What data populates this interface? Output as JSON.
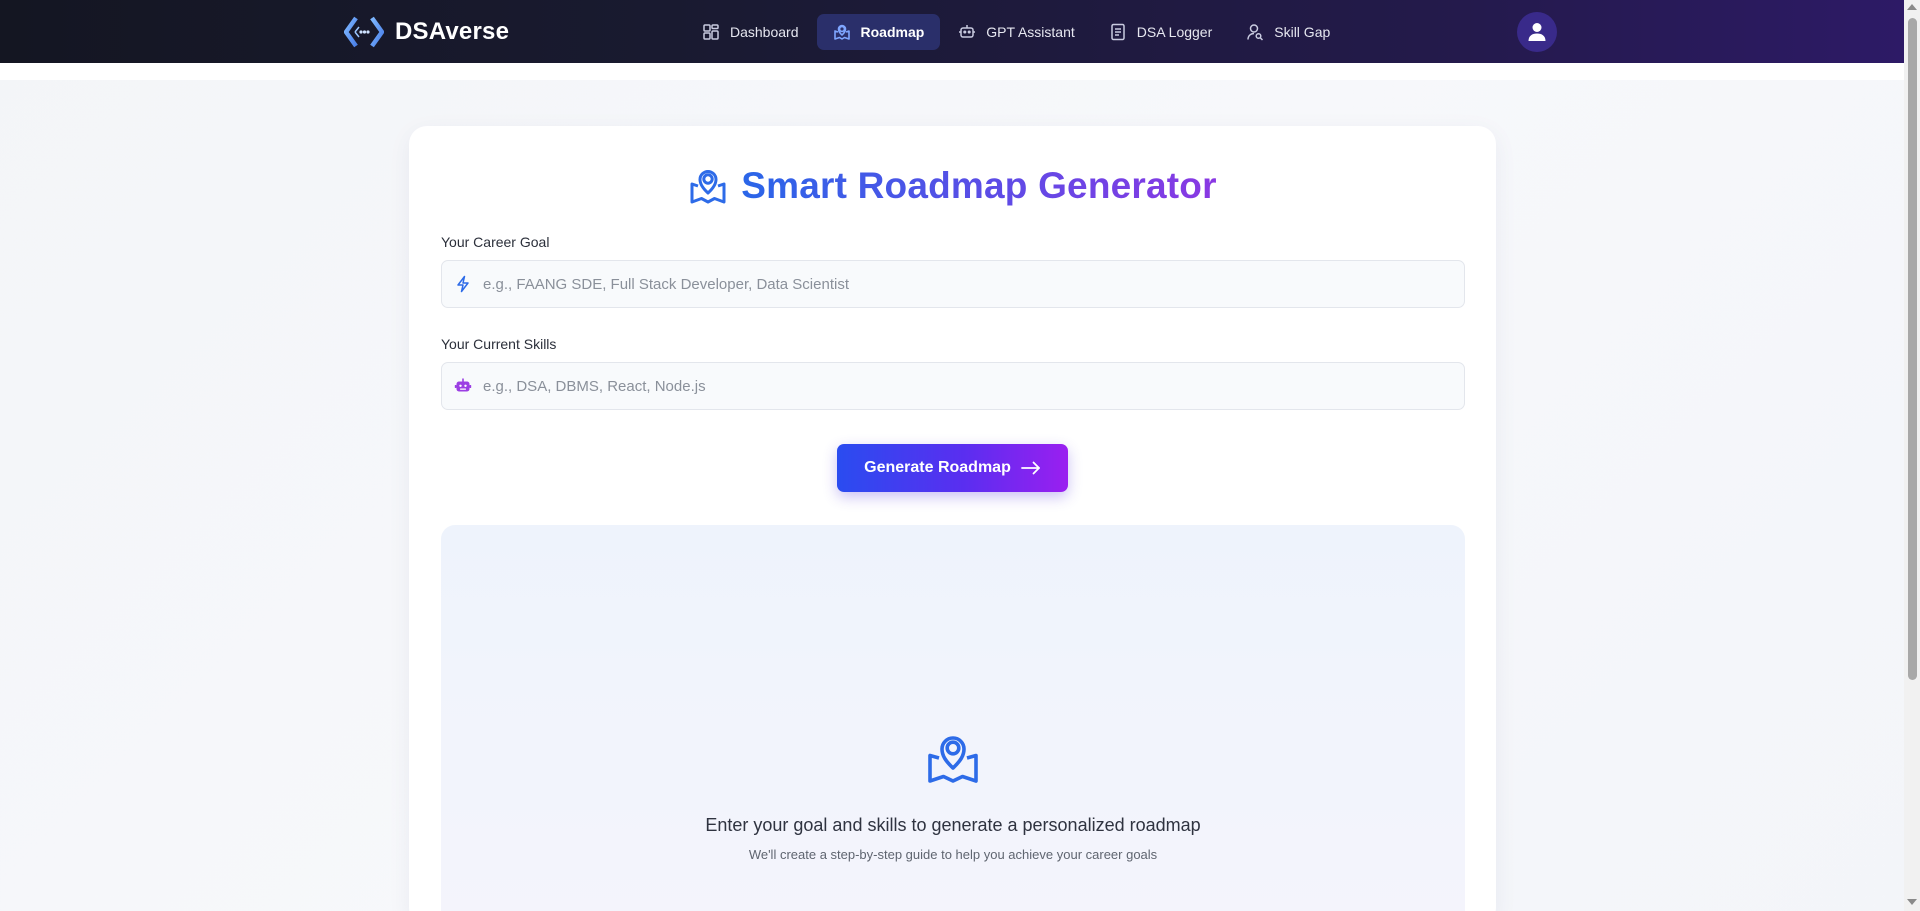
{
  "app": {
    "name": "DSAverse"
  },
  "nav": {
    "items": [
      {
        "label": "Dashboard",
        "icon": "dashboard-grid-icon",
        "active": false
      },
      {
        "label": "Roadmap",
        "icon": "map-pin-icon",
        "active": true
      },
      {
        "label": "GPT Assistant",
        "icon": "robot-icon",
        "active": false
      },
      {
        "label": "DSA Logger",
        "icon": "document-icon",
        "active": false
      },
      {
        "label": "Skill Gap",
        "icon": "user-search-icon",
        "active": false
      }
    ],
    "avatar_icon": "user-icon"
  },
  "page": {
    "title": "Smart Roadmap Generator",
    "title_icon": "map-pin-icon",
    "career_goal": {
      "label": "Your Career Goal",
      "value": "",
      "placeholder": "e.g., FAANG SDE, Full Stack Developer, Data Scientist",
      "icon": "lightning-icon"
    },
    "current_skills": {
      "label": "Your Current Skills",
      "value": "",
      "placeholder": "e.g., DSA, DBMS, React, Node.js",
      "icon": "robot-icon"
    },
    "generate_button": "Generate Roadmap",
    "empty_state": {
      "icon": "map-pin-icon",
      "title": "Enter your goal and skills to generate a personalized roadmap",
      "subtitle": "We'll create a step-by-step guide to help you achieve your career goals"
    }
  },
  "colors": {
    "accent_blue": "#2a66e8",
    "accent_purple": "#8a38e3",
    "nav_active_bg": "#2a2f6a"
  }
}
